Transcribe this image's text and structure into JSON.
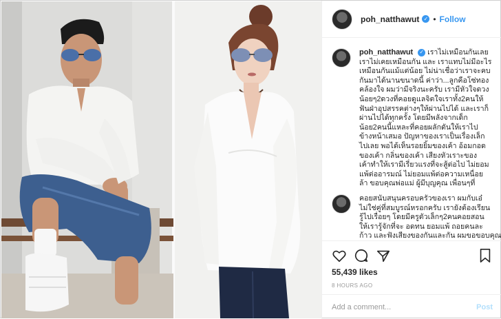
{
  "post": {
    "username": "poh_natthawut",
    "follow_label": "Follow",
    "separator": "•"
  },
  "caption": {
    "username": "poh_natthawut",
    "lines": [
      "เราไม่เหมือนกันเลย",
      "เราไม่เคยเหมือนกัน และ เราแทบไม่มีอะไร",
      "เหมือนกันแม้แต่น้อย ไม่น่าเชื่อว่าเราจะคบ",
      "กันมาได้นานขนาดนี้ ค่าว่า...ลูกคือโซ่ทอง",
      "คล้องใจ ผมว่ามีจริงนะครับ เรามีหัวใจดวง",
      "น้อยๆ2ดวงที่คอยดูแลจิตใจเราทั้ง2คนให้",
      "ฟันฝ่าอุปสรรคต่างๆให้ผ่านไปได้ และเราก็",
      "ผ่านไปได้ทุกครั้ง โดยมีพลังจากเด็ก",
      "น้อย2คนนี้แหละที่คอยผลักดันให้เราไป",
      "ข้างหน้าเสมอ ปัญหาของเราเป็นเรื่องเล็ก",
      "ไปเลย พอได้เห็นรอยยิ้มของเค้า อ้อมกอด",
      "ของเค้า กลิ่นของเค้า เสียงหัวเราะของ",
      "เค้าทำให้เรามีเรี่ยวแรงที่จะสู้ต่อไป ไม่ยอม",
      "แพ้ต่ออารมณ์ ไม่ยอมแพ้ต่อความเหนื่อย",
      "ล้า ขอบคุณพ่อแม่ ผู้มีบุญคุณ เพื่อนๆที่"
    ]
  },
  "comment2": {
    "lines": [
      "คอยสนับสนุนครอบครัวของเรา ผมกับเอ๋",
      "ไม่ใช่คู่ที่สมบูรณ์หรอกครับ เรายังต้องเรียน",
      "รู้ไปเรื่อยๆ โดยมีครูตัวเล็กๆ2คนคอยสอน",
      "ให้เรารู้จักที่จะ อดทน ยอมแพ้ ถอยคนละ",
      "ก้าว และฟังเสียงของกันและกัน ผมขอขอบคุณ"
    ]
  },
  "actions": {
    "likes": "55,439 likes",
    "time": "8 HOURS AGO"
  },
  "comment_box": {
    "placeholder": "Add a comment...",
    "post_label": "Post"
  },
  "icons": [
    "heart-icon",
    "comment-icon",
    "share-icon",
    "bookmark-icon",
    "verified-icon"
  ]
}
